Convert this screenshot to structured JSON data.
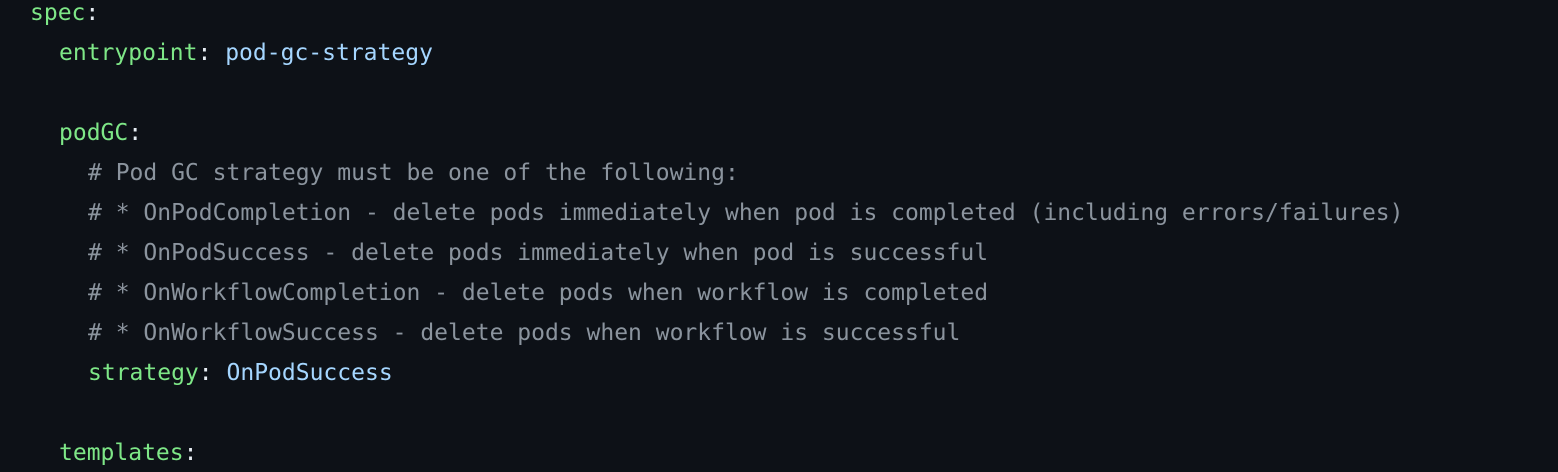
{
  "colors": {
    "background": "#0d1117",
    "key": "#7ee787",
    "value": "#a5d6ff",
    "comment": "#8b949e",
    "punctuation": "#e6edf3"
  },
  "code": {
    "spec_key": "spec",
    "colon": ":",
    "entrypoint_key": "entrypoint",
    "entrypoint_value": "pod-gc-strategy",
    "podgc_key": "podGC",
    "comments": [
      "# Pod GC strategy must be one of the following:",
      "# * OnPodCompletion - delete pods immediately when pod is completed (including errors/failures)",
      "# * OnPodSuccess - delete pods immediately when pod is successful",
      "# * OnWorkflowCompletion - delete pods when workflow is completed",
      "# * OnWorkflowSuccess - delete pods when workflow is successful"
    ],
    "strategy_key": "strategy",
    "strategy_value": "OnPodSuccess",
    "templates_key": "templates"
  }
}
